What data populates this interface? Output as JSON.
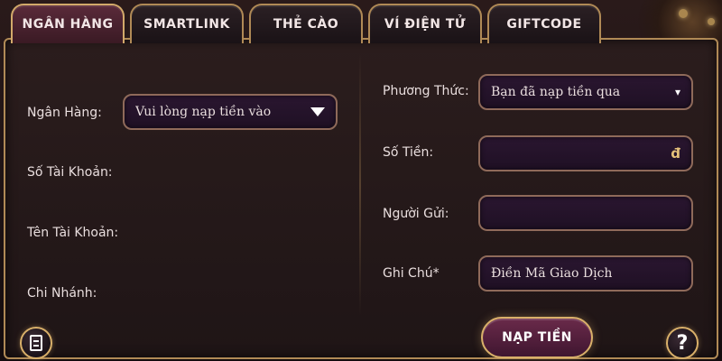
{
  "tabs": [
    {
      "label": "NGÂN HÀNG",
      "active": true
    },
    {
      "label": "SMARTLINK",
      "active": false
    },
    {
      "label": "THẺ CÀO",
      "active": false
    },
    {
      "label": "VÍ ĐIỆN TỬ",
      "active": false
    },
    {
      "label": "GIFTCODE",
      "active": false
    }
  ],
  "left_form": {
    "bank_label": "Ngân Hàng:",
    "bank_select_value": "Vui lòng nạp tiền vào",
    "account_number_label": "Số Tài Khoản:",
    "account_name_label": "Tên Tài Khoản:",
    "branch_label": "Chi Nhánh:"
  },
  "right_form": {
    "method_label": "Phương Thức:",
    "method_value": "Bạn đã nạp tiền qua",
    "amount_label": "Số Tiền:",
    "amount_unit": "đ",
    "sender_label": "Người Gửi:",
    "note_label": "Ghi Chú*",
    "note_placeholder": "Điền Mã Giao Dịch"
  },
  "submit_label": "NẠP TIỀN",
  "help_label": "?",
  "colors": {
    "border_gold": "#b08a56",
    "field_bg": "#2a1630",
    "active_tab": "#5a2a3a",
    "button_bg": "#6a2a4a"
  },
  "icons": {
    "history": "history-icon",
    "help": "help-icon",
    "dropdown": "chevron-down-icon"
  }
}
